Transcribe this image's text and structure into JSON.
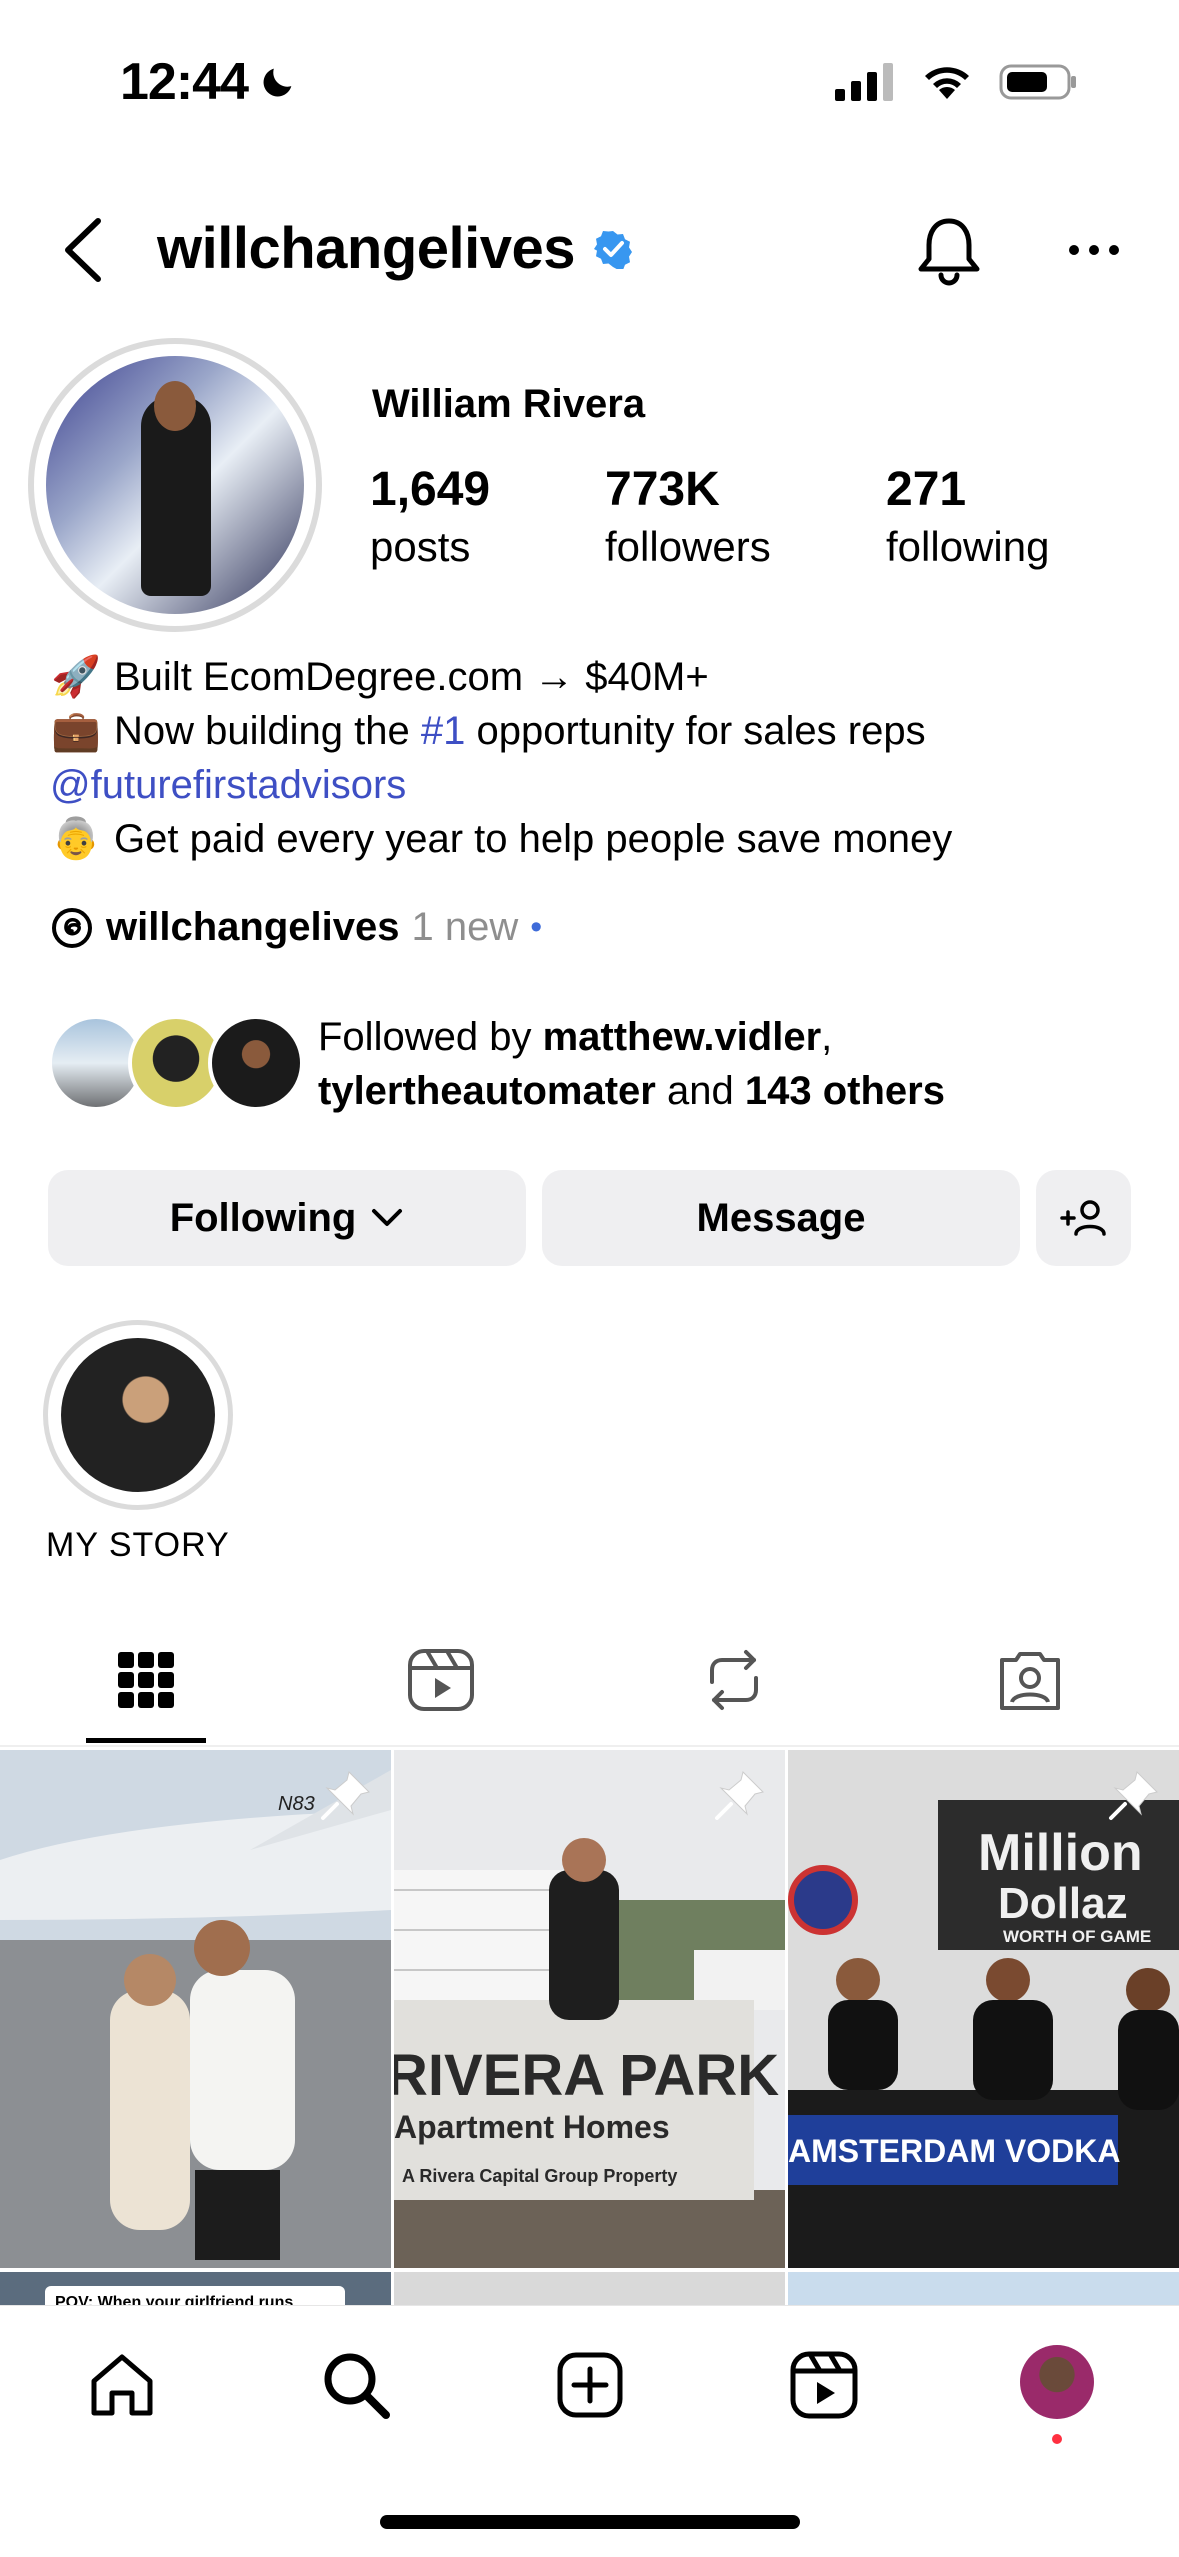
{
  "status_bar": {
    "time": "12:44",
    "icons": [
      "moon-icon",
      "signal-icon",
      "wifi-icon",
      "battery-icon"
    ]
  },
  "header": {
    "username": "willchangelives",
    "verified": true,
    "icons": [
      "back-chevron-icon",
      "bell-icon",
      "more-icon"
    ]
  },
  "profile": {
    "full_name": "William Rivera",
    "stats": [
      {
        "value": "1,649",
        "label": "posts"
      },
      {
        "value": "773K",
        "label": "followers"
      },
      {
        "value": "271",
        "label": "following"
      }
    ],
    "bio": [
      {
        "emoji": "🚀",
        "parts": [
          {
            "text": "Built EcomDegree.com → $40M+",
            "link": false
          }
        ]
      },
      {
        "emoji": "💼",
        "parts": [
          {
            "text": "Now building the ",
            "link": false
          },
          {
            "text": "#1",
            "link": true
          },
          {
            "text": " opportunity for sales reps",
            "link": false
          }
        ]
      },
      {
        "emoji": "",
        "parts": [
          {
            "text": "@futurefirstadvisors",
            "link": true
          }
        ]
      },
      {
        "emoji": "👵",
        "parts": [
          {
            "text": "Get paid every year to help people save money",
            "link": false
          }
        ]
      }
    ],
    "threads": {
      "handle": "willchangelives",
      "badge": "1 new",
      "dot": "•"
    },
    "followed_by": {
      "prefix": "Followed by ",
      "user1": "matthew.vidler",
      "sep": ",",
      "user2": "tylertheautomater",
      "mid": " and ",
      "others": "143 others"
    }
  },
  "buttons": {
    "following": "Following",
    "message": "Message"
  },
  "highlights": [
    {
      "label": "MY STORY"
    }
  ],
  "tabs": [
    "grid-icon",
    "reels-icon",
    "reposts-icon",
    "tagged-icon"
  ],
  "grid": {
    "tile1": {
      "caption": "N83"
    },
    "tile2": {
      "sign_line1": "RIVERA PARK",
      "sign_line2": "Apartment Homes",
      "sign_line3": "A Rivera Capital Group Property"
    },
    "tile3": {
      "sign_line1": "Million",
      "sign_line2": "Dollaz",
      "sign_line3": "WORTH OF GAME",
      "banner": "AMSTERDAM VODKA"
    },
    "row2_caption": "POV: When your girlfriend runs"
  },
  "bottom_nav": [
    "home-icon",
    "search-icon",
    "create-icon",
    "reels-icon",
    "profile-avatar"
  ]
}
